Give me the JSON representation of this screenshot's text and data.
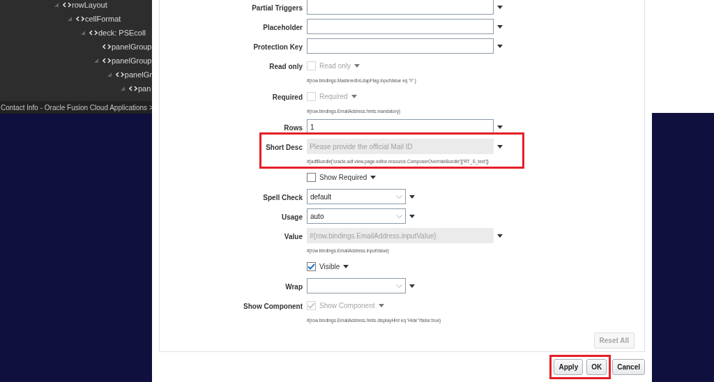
{
  "tree": [
    {
      "label": "rowLayout",
      "expanded": true,
      "children": [
        {
          "label": "cellFormat",
          "expanded": true,
          "children": [
            {
              "label": "deck: PSEcoll",
              "expanded": true,
              "children": [
                {
                  "label": "panelGroup",
                  "expanded": false
                },
                {
                  "label": "panelGroup",
                  "expanded": true,
                  "children": [
                    {
                      "label": "panelGr",
                      "expanded": true,
                      "children": [
                        {
                          "label": "pan",
                          "expanded": true
                        }
                      ]
                    }
                  ]
                }
              ]
            }
          ]
        }
      ]
    }
  ],
  "status_bar": "Contact Info - Oracle Fusion Cloud Applications >",
  "properties": [
    {
      "kind": "text",
      "label": "Partial Triggers",
      "disabled": false,
      "highlighted": false
    },
    {
      "kind": "text",
      "label": "Placeholder",
      "disabled": false,
      "highlighted": false
    },
    {
      "kind": "text",
      "label": "Protection Key",
      "disabled": false,
      "highlighted": false
    },
    {
      "kind": "checkbox",
      "label": "Read only",
      "text": "Read only",
      "checked": false,
      "disabled": true,
      "hint": "#{row.bindings.MasteredInLdapFlag.inputValue eq 'Y' }",
      "highlighted": false
    },
    {
      "kind": "checkbox",
      "label": "Required",
      "text": "Required",
      "checked": false,
      "disabled": true,
      "hint": "#{row.bindings.EmailAddress.hints.mandatory}",
      "highlighted": false
    },
    {
      "kind": "text",
      "label": "Rows",
      "value": "1",
      "disabled": false,
      "highlighted": false
    },
    {
      "kind": "text",
      "label": "Short Desc",
      "value": "Please provide the official Mail ID",
      "disabled": true,
      "hint": "#{adfBundle['oracle.adf.view.page.editor.resource.ComposerOverrideBundle']['RT_S_text']}",
      "highlighted": true
    },
    {
      "kind": "checkbox",
      "text": "Show Required",
      "checked": false,
      "disabled": false,
      "highlighted": false
    },
    {
      "kind": "select",
      "label": "Spell Check",
      "value": "default",
      "highlighted": false
    },
    {
      "kind": "select",
      "label": "Usage",
      "value": "auto",
      "highlighted": false
    },
    {
      "kind": "text",
      "label": "Value",
      "value": "#{row.bindings.EmailAddress.inputValue}",
      "disabled": true,
      "hint": "#{row.bindings.EmailAddress.inputValue}",
      "highlighted": false
    },
    {
      "kind": "checkbox",
      "text": "Visible",
      "checked": true,
      "disabled": false,
      "highlighted": false
    },
    {
      "kind": "select",
      "label": "Wrap",
      "highlighted": false
    },
    {
      "kind": "checkbox",
      "label": "Show Component",
      "text": "Show Component",
      "checked": true,
      "disabled": true,
      "hint": "#{row.bindings.EmailAddress.hints.displayHint eq 'Hide'?false:true}",
      "highlighted": false
    }
  ],
  "reset_button": {
    "label": "Reset All",
    "disabled": true
  },
  "buttons": [
    {
      "label": "Apply",
      "highlighted": true
    },
    {
      "label": "OK",
      "highlighted": true
    },
    {
      "label": "Cancel",
      "highlighted": false
    }
  ]
}
